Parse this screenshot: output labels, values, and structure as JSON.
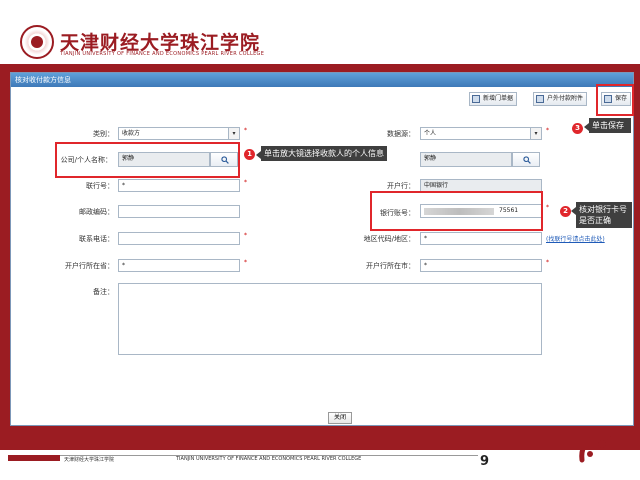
{
  "header": {
    "university_cn": "天津财经大学珠江学院",
    "university_en": "TIANJIN UNIVERSITY OF FINANCE AND ECONOMICS PEARL RIVER COLLEGE"
  },
  "window": {
    "title": "核对收付款方信息"
  },
  "toolbar": {
    "btn1": "新增门单据",
    "btn2": "户外付款附件",
    "save": "保存"
  },
  "form": {
    "type_label": "类别：",
    "type_value": "收款方",
    "data_source_label": "数据源：",
    "data_source_value": "个人",
    "name_label": "公司/个人名称：",
    "name_value": "郭静",
    "name2_value": "郭静",
    "bank_label": "联行号：",
    "bank_value": "*",
    "open_bank_label": "开户行：",
    "open_bank_value": "中国银行",
    "postcode_label": "邮政编码：",
    "account_label": "银行账号：",
    "account_suffix": "75561",
    "contact_label": "联系电话：",
    "region_label": "地区代码/地区：",
    "open_province_label": "开户行所在省：",
    "open_city_label": "开户行所在市：",
    "remark_label": "备注：",
    "link_text": "(找联行号请点击此处)",
    "close_label": "关闭"
  },
  "callouts": {
    "c1_num": "1",
    "c1_text": "单击放大镜选择收款人的个人信息",
    "c2_num": "2",
    "c2_text": "核对银行卡号是否正确",
    "c3_num": "3",
    "c3_text": "单击保存"
  },
  "footer": {
    "cn": "天津财经大学珠江学院",
    "en": "TIANJIN UNIVERSITY OF FINANCE AND ECONOMICS PEARL RIVER COLLEGE",
    "page": "9"
  },
  "colors": {
    "brand_red": "#9b1c22",
    "highlight_red": "#e0262b",
    "title_blue": "#3e79b8",
    "callout_bg": "#3f3f3f"
  },
  "icons": [
    "university-seal-icon",
    "search-icon",
    "save-icon",
    "document-icon",
    "dropdown-arrow-icon",
    "decorative-logo-icon"
  ]
}
